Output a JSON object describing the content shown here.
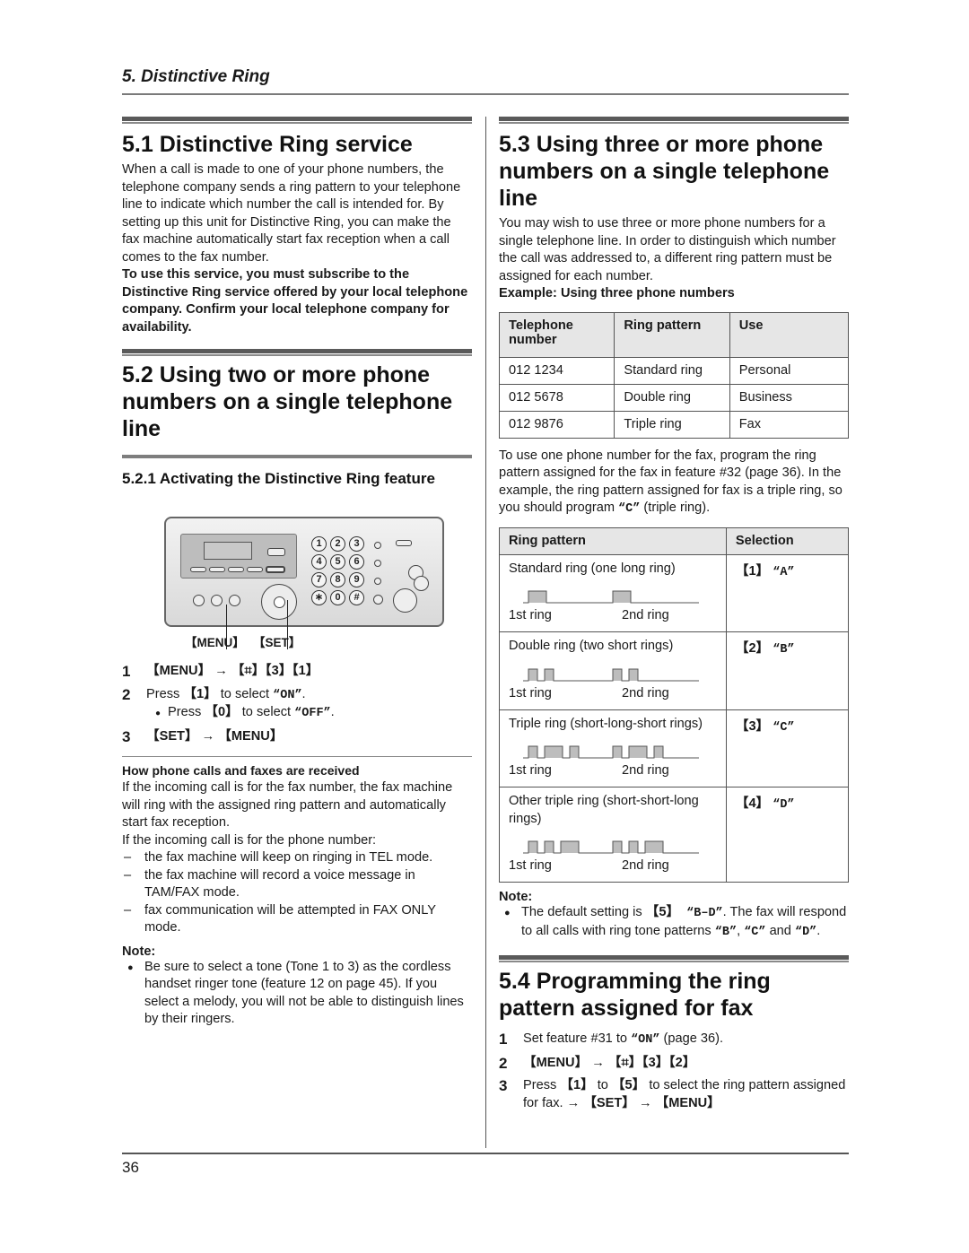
{
  "header": {
    "chapter": "5. Distinctive Ring"
  },
  "left": {
    "s51": {
      "title": "5.1 Distinctive Ring service",
      "body": "When a call is made to one of your phone numbers, the telephone company sends a ring pattern to your telephone line to indicate which number the call is intended for. By setting up this unit for Distinctive Ring, you can make the fax machine automatically start fax reception when a call comes to the fax number.",
      "bold": "To use this service, you must subscribe to the Distinctive Ring service offered by your local telephone company. Confirm your local telephone company for availability."
    },
    "s52": {
      "title": "5.2 Using two or more phone numbers on a single telephone line",
      "sub_title": "5.2.1 Activating the Distinctive Ring feature",
      "figure": {
        "labels": [
          "【MENU】",
          "【SET】"
        ],
        "dial_keys": [
          "1",
          "2",
          "3",
          "4",
          "5",
          "6",
          "7",
          "8",
          "9",
          "∗",
          "0",
          "#"
        ]
      },
      "steps": [
        {
          "num": "1",
          "parts": [
            "【MENU】",
            " → ",
            "【⌗】【3】【1】"
          ]
        },
        {
          "num": "2",
          "pre": "Press ",
          "key": "【1】",
          "mid": " to select ",
          "val": "“ON”",
          "post": ".",
          "sub": {
            "pre": "Press ",
            "key": "【0】",
            "mid": " to select ",
            "val": "“OFF”",
            "post": "."
          }
        },
        {
          "num": "3",
          "parts": [
            "【SET】",
            " → ",
            "【MENU】"
          ]
        }
      ],
      "how_title": "How phone calls and faxes are received",
      "how_body1": "If the incoming call is for the fax number, the fax machine will ring with the assigned ring pattern and automatically start fax reception.",
      "how_body2": "If the incoming call is for the phone number:",
      "how_list": [
        "the fax machine will keep on ringing in TEL mode.",
        "the fax machine will record a voice message in TAM/FAX mode.",
        "fax communication will be attempted in FAX ONLY mode."
      ],
      "note_title": "Note:",
      "notes": [
        "Be sure to select a tone (Tone 1 to 3) as the cordless handset ringer tone (feature 12 on page 45). If you select a melody, you will not be able to distinguish lines by their ringers."
      ]
    }
  },
  "right": {
    "s53": {
      "title": "5.3 Using three or more phone numbers on a single telephone line",
      "body": "You may wish to use three or more phone numbers for a single telephone line. In order to distinguish which number the call was addressed to, a different ring pattern must be assigned for each number.",
      "example_title": "Example: Using three phone numbers",
      "table1": {
        "headers": [
          "Telephone number",
          "Ring pattern",
          "Use"
        ],
        "rows": [
          [
            "012 1234",
            "Standard ring",
            "Personal"
          ],
          [
            "012 5678",
            "Double ring",
            "Business"
          ],
          [
            "012 9876",
            "Triple ring",
            "Fax"
          ]
        ]
      },
      "after_table": "To use one phone number for the fax, program the ring pattern assigned for the fax in feature #32 (page 36). In the example, the ring pattern assigned for fax is a triple ring, so you should program ",
      "after_table_val": "“C”",
      "after_table_post": " (triple ring).",
      "table2": {
        "headers": [
          "Ring pattern",
          "Selection"
        ],
        "ring_label_1": "1st ring",
        "ring_label_2": "2nd ring",
        "rows": [
          {
            "desc": "Standard ring (one long ring)",
            "key": "【1】",
            "val": "“A”",
            "pattern": [
              "L"
            ]
          },
          {
            "desc": "Double ring (two short rings)",
            "key": "【2】",
            "val": "“B”",
            "pattern": [
              "S",
              "S"
            ]
          },
          {
            "desc": "Triple ring (short-long-short rings)",
            "key": "【3】",
            "val": "“C”",
            "pattern": [
              "S",
              "L",
              "S"
            ]
          },
          {
            "desc": "Other triple ring (short-short-long rings)",
            "key": "【4】",
            "val": "“D”",
            "pattern": [
              "S",
              "S",
              "L"
            ]
          }
        ]
      },
      "note_title": "Note:",
      "note": {
        "pre": "The default setting is ",
        "key": "【5】",
        "val": " “B–D”",
        "mid": ". The fax will respond to all calls with ring tone patterns ",
        "v1": "“B”",
        "sep1": ", ",
        "v2": "“C”",
        "sep2": " and ",
        "v3": "“D”",
        "post": "."
      }
    },
    "s54": {
      "title": "5.4 Programming the ring pattern assigned for fax",
      "steps": [
        {
          "num": "1",
          "pre": "Set feature #31 to ",
          "val": "“ON”",
          "post": " (page 36)."
        },
        {
          "num": "2",
          "parts": [
            "【MENU】",
            " → ",
            "【⌗】【3】【2】"
          ]
        },
        {
          "num": "3",
          "pre": "Press ",
          "k1": "【1】",
          "mid": " to ",
          "k2": "【5】",
          "mid2": " to select the ring pattern assigned for fax. → ",
          "k3": "【SET】",
          "arrow": " → ",
          "k4": "【MENU】"
        }
      ]
    }
  },
  "footer": {
    "page_number": "36"
  }
}
